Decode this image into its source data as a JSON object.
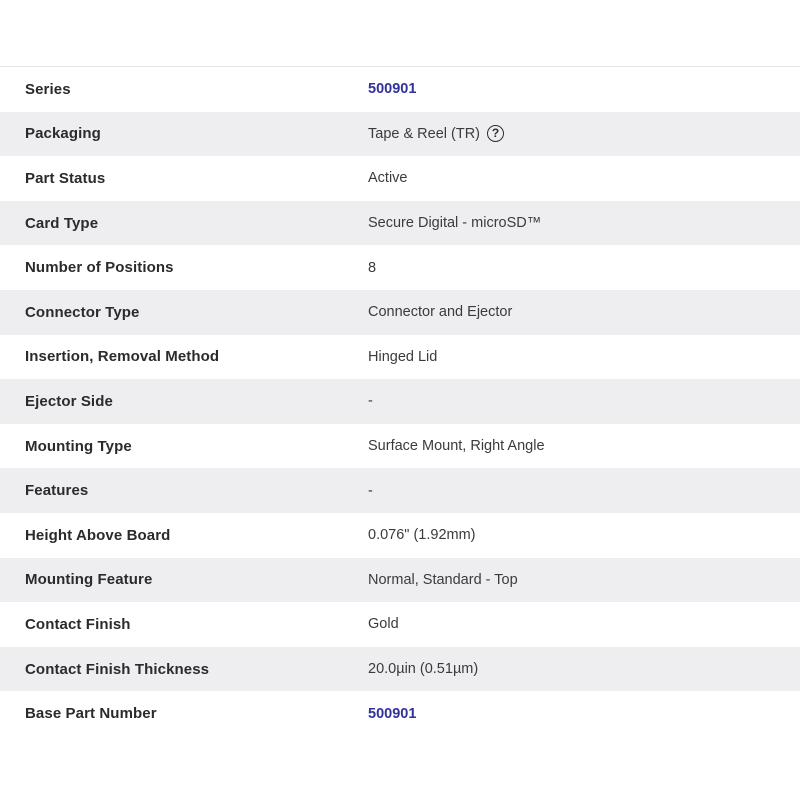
{
  "table": {
    "link_color": "#32329c",
    "stripe_color": "#eeeef1",
    "row_color": "#ffffff",
    "label_color": "#2b2b2b",
    "value_color": "#3b3b3b",
    "rows": [
      {
        "label": "Series",
        "value": "500901",
        "type": "link",
        "help": false
      },
      {
        "label": "Packaging",
        "value": "Tape & Reel (TR)",
        "type": "text",
        "help": true,
        "help_glyph": "?"
      },
      {
        "label": "Part Status",
        "value": "Active",
        "type": "text",
        "help": false
      },
      {
        "label": "Card Type",
        "value": "Secure Digital - microSD™",
        "type": "text",
        "help": false
      },
      {
        "label": "Number of Positions",
        "value": "8",
        "type": "text",
        "help": false
      },
      {
        "label": "Connector Type",
        "value": "Connector and Ejector",
        "type": "text",
        "help": false
      },
      {
        "label": "Insertion, Removal Method",
        "value": "Hinged Lid",
        "type": "text",
        "help": false
      },
      {
        "label": "Ejector Side",
        "value": "-",
        "type": "text",
        "help": false
      },
      {
        "label": "Mounting Type",
        "value": "Surface Mount, Right Angle",
        "type": "text",
        "help": false
      },
      {
        "label": "Features",
        "value": "-",
        "type": "text",
        "help": false
      },
      {
        "label": "Height Above Board",
        "value": "0.076\" (1.92mm)",
        "type": "text",
        "help": false
      },
      {
        "label": "Mounting Feature",
        "value": "Normal, Standard - Top",
        "type": "text",
        "help": false
      },
      {
        "label": "Contact Finish",
        "value": "Gold",
        "type": "text",
        "help": false
      },
      {
        "label": "Contact Finish Thickness",
        "value": "20.0µin (0.51µm)",
        "type": "text",
        "help": false
      },
      {
        "label": "Base Part Number",
        "value": "500901",
        "type": "link",
        "help": false
      }
    ]
  }
}
